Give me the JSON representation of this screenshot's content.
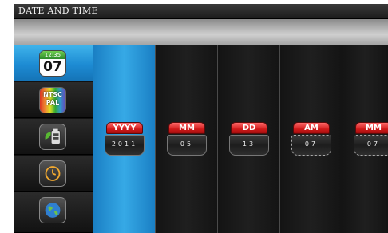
{
  "window": {
    "title": "DATE AND TIME"
  },
  "sidebar": {
    "items": [
      {
        "name": "date-time",
        "icon": "calendar-icon",
        "icon_top": "12:35",
        "icon_main": "07",
        "active": true
      },
      {
        "name": "video-format",
        "icon": "ntsc-pal-icon",
        "line1": "NTSC",
        "line2": "PAL",
        "active": false
      },
      {
        "name": "battery",
        "icon": "battery-icon",
        "active": false
      },
      {
        "name": "timer",
        "icon": "clock-icon",
        "active": false
      },
      {
        "name": "globe",
        "icon": "globe-icon",
        "active": false
      }
    ]
  },
  "fields": [
    {
      "label": "YYYY",
      "value": "2011",
      "selected": true
    },
    {
      "label": "MM",
      "value": "05",
      "selected": false
    },
    {
      "label": "DD",
      "value": "13",
      "selected": false
    },
    {
      "label": "AM",
      "value": "07",
      "selected": false
    },
    {
      "label": "MM",
      "value": "07",
      "selected": false
    }
  ],
  "colors": {
    "accent_blue": "#2a9ad9",
    "label_red": "#d11a1a",
    "background": "#0d0d0d"
  }
}
